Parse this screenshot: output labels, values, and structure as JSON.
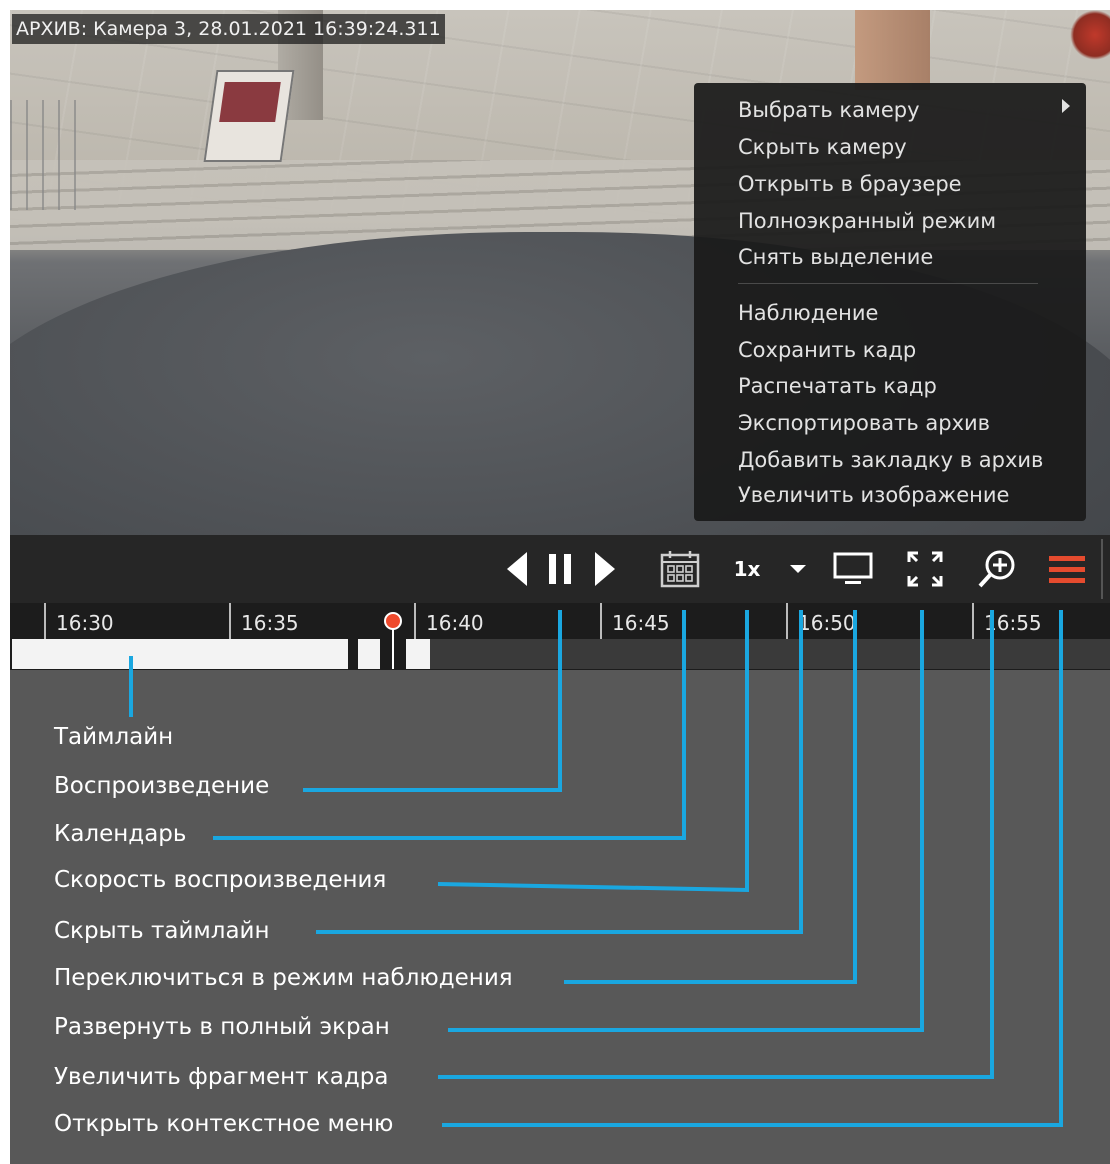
{
  "video": {
    "osd_title": "АРХИВ: Камера 3, 28.01.2021 16:39:24.311"
  },
  "context_menu": {
    "items": [
      {
        "label": "Выбрать камеру",
        "submenu": true
      },
      {
        "label": "Скрыть камеру"
      },
      {
        "label": "Открыть в браузере"
      },
      {
        "label": "Полноэкранный режим"
      },
      {
        "label": "Снять выделение"
      },
      {
        "label": "Наблюдение"
      },
      {
        "label": "Сохранить кадр"
      },
      {
        "label": "Распечатать кадр"
      },
      {
        "label": "Экспортировать архив"
      },
      {
        "label": "Добавить закладку в архив"
      },
      {
        "label": "Увеличить изображение"
      }
    ]
  },
  "toolbar": {
    "speed_label": "1x",
    "icons": [
      "step-back-icon",
      "pause-icon",
      "step-forward-icon",
      "calendar-icon",
      "speed-dropdown-icon",
      "monitor-icon",
      "fullscreen-icon",
      "zoom-in-icon",
      "hamburger-menu-icon"
    ],
    "accent_color": "#e54b2e"
  },
  "timeline": {
    "ticks": [
      "16:30",
      "16:35",
      "16:40",
      "16:45",
      "16:50",
      "16:55"
    ],
    "cursor_color": "#ef4a2d"
  },
  "legend": {
    "items": [
      "Таймлайн",
      "Воспроизведение",
      "Календарь",
      "Скорость воспроизведения",
      "Скрыть таймлайн",
      "Переключиться в режим наблюдения",
      "Развернуть в полный экран",
      "Увеличить фрагмент кадра",
      "Открыть контекстное меню"
    ],
    "leader_color": "#1aa7e0"
  }
}
